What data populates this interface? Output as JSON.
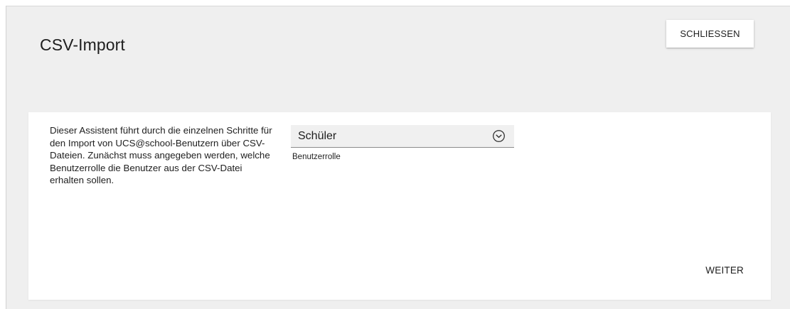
{
  "header": {
    "title": "CSV-Import",
    "close_label": "SCHLIESSEN"
  },
  "wizard": {
    "description": "Dieser Assistent führt durch die einzelnen Schritte für den Import von UCS@school-Benutzern über CSV-Dateien. Zunächst muss angegeben werden, welche Benutzerrolle die Benutzer aus der CSV-Datei erhalten sollen.",
    "role_select": {
      "value": "Schüler",
      "label": "Benutzerrolle",
      "icon": "chevron-down-circle-icon"
    },
    "next_label": "WEITER"
  },
  "colors": {
    "background": "#efefef",
    "panel": "#ffffff",
    "text": "#1e1e1e",
    "select_fill": "#f0f0f0"
  }
}
